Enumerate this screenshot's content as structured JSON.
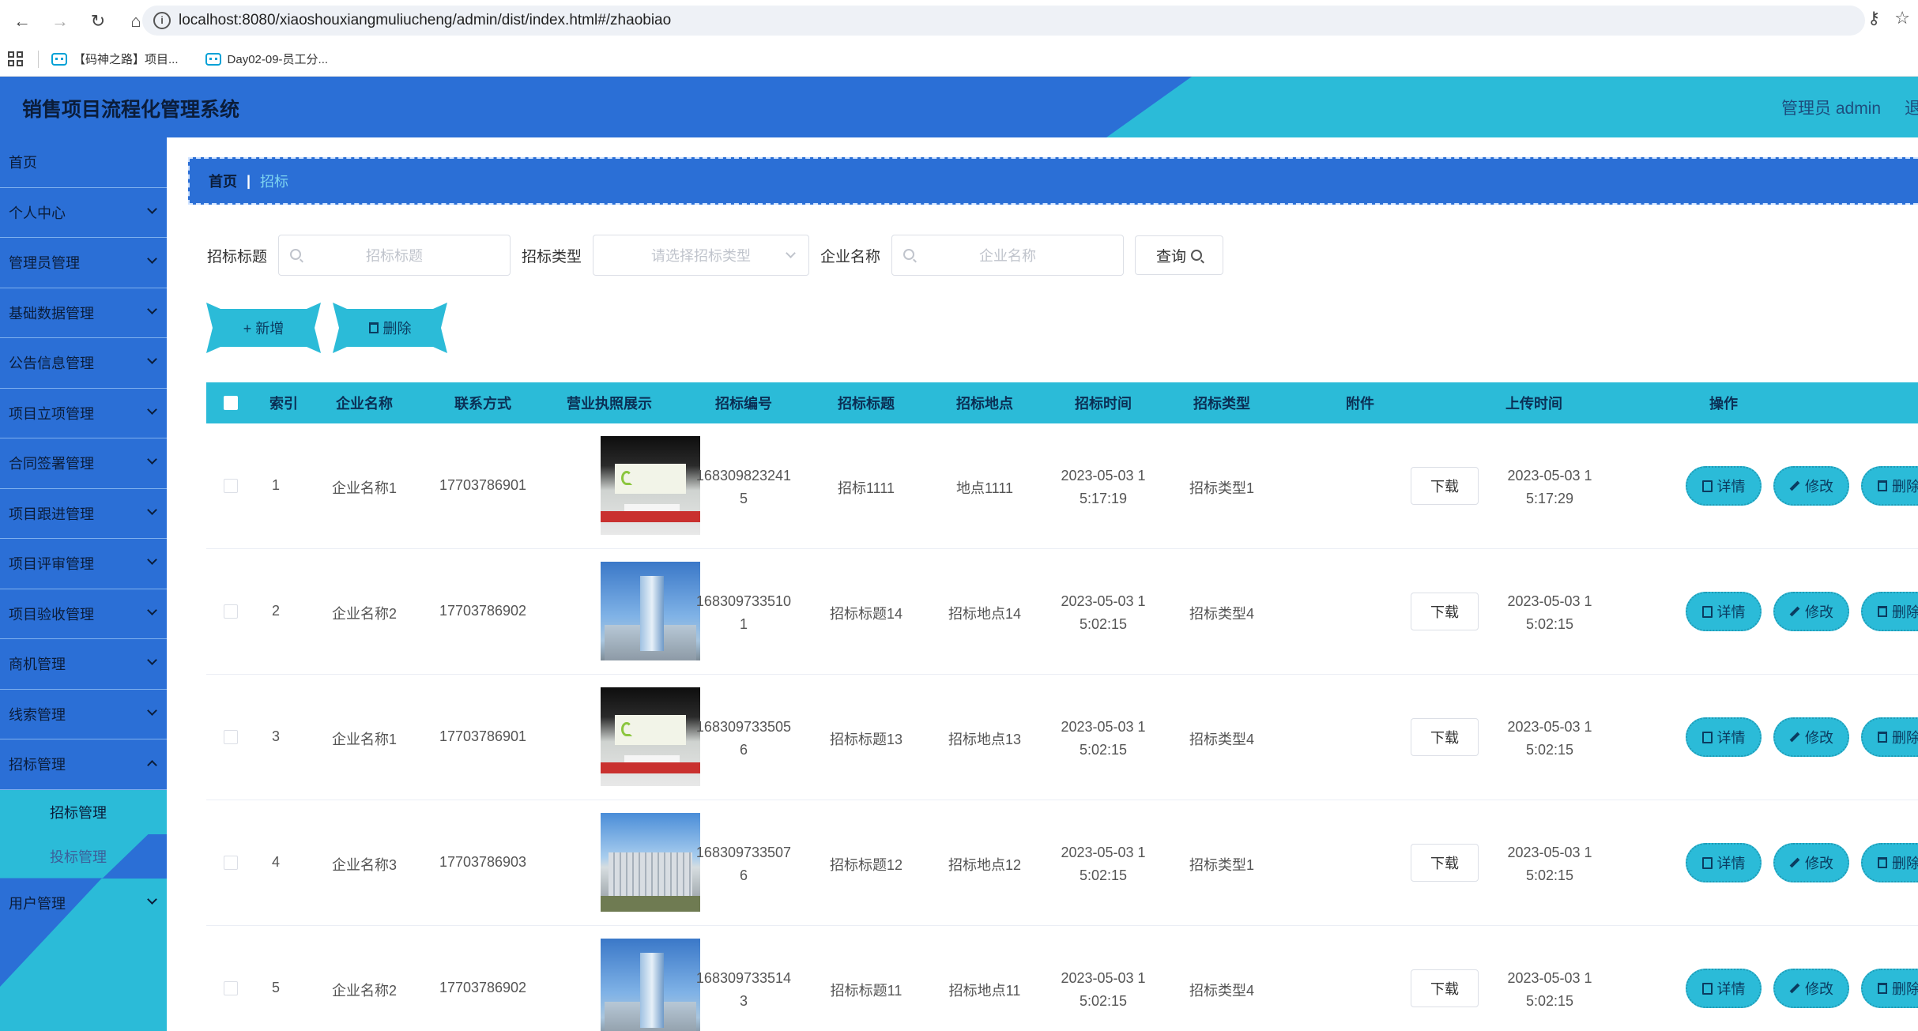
{
  "browser": {
    "url": "localhost:8080/xiaoshouxiangmuliucheng/admin/dist/index.html#/zhaobiao",
    "bookmarks": [
      "【码神之路】项目...",
      "Day02-09-员工分..."
    ]
  },
  "header": {
    "title": "销售项目流程化管理系统",
    "user": "管理员 admin",
    "logout": "退"
  },
  "sidebar": {
    "items": [
      {
        "label": "首页"
      },
      {
        "label": "个人中心"
      },
      {
        "label": "管理员管理"
      },
      {
        "label": "基础数据管理"
      },
      {
        "label": "公告信息管理"
      },
      {
        "label": "项目立项管理"
      },
      {
        "label": "合同签署管理"
      },
      {
        "label": "项目跟进管理"
      },
      {
        "label": "项目评审管理"
      },
      {
        "label": "项目验收管理"
      },
      {
        "label": "商机管理"
      },
      {
        "label": "线索管理"
      },
      {
        "label": "招标管理"
      }
    ],
    "sub_items": [
      "招标管理",
      "投标管理"
    ],
    "last_item": "用户管理"
  },
  "breadcrumb": {
    "home": "首页",
    "sep": "|",
    "current": "招标"
  },
  "search": {
    "title_label": "招标标题",
    "title_placeholder": "招标标题",
    "type_label": "招标类型",
    "type_placeholder": "请选择招标类型",
    "company_label": "企业名称",
    "company_placeholder": "企业名称",
    "query_button": "查询"
  },
  "actions": {
    "add": "+ 新增",
    "delete": "删除"
  },
  "table": {
    "columns": [
      "索引",
      "企业名称",
      "联系方式",
      "营业执照展示",
      "招标编号",
      "招标标题",
      "招标地点",
      "招标时间",
      "招标类型",
      "附件",
      "上传时间",
      "操作"
    ],
    "download_label": "下载",
    "op_labels": [
      "详情",
      "修改",
      "删除"
    ],
    "rows": [
      {
        "index": "1",
        "company": "企业名称1",
        "phone": "17703786901",
        "image": "lobby",
        "code_a": "168309823241",
        "code_b": "5",
        "title": "招标1111",
        "place": "地点1111",
        "time_a": "2023-05-03 1",
        "time_b": "5:17:19",
        "type": "招标类型1",
        "upload_a": "2023-05-03 1",
        "upload_b": "5:17:29"
      },
      {
        "index": "2",
        "company": "企业名称2",
        "phone": "17703786902",
        "image": "tower",
        "code_a": "168309733510",
        "code_b": "1",
        "title": "招标标题14",
        "place": "招标地点14",
        "time_a": "2023-05-03 1",
        "time_b": "5:02:15",
        "type": "招标类型4",
        "upload_a": "2023-05-03 1",
        "upload_b": "5:02:15"
      },
      {
        "index": "3",
        "company": "企业名称1",
        "phone": "17703786901",
        "image": "lobby",
        "code_a": "168309733505",
        "code_b": "6",
        "title": "招标标题13",
        "place": "招标地点13",
        "time_a": "2023-05-03 1",
        "time_b": "5:02:15",
        "type": "招标类型4",
        "upload_a": "2023-05-03 1",
        "upload_b": "5:02:15"
      },
      {
        "index": "4",
        "company": "企业名称3",
        "phone": "17703786903",
        "image": "campus",
        "code_a": "168309733507",
        "code_b": "6",
        "title": "招标标题12",
        "place": "招标地点12",
        "time_a": "2023-05-03 1",
        "time_b": "5:02:15",
        "type": "招标类型1",
        "upload_a": "2023-05-03 1",
        "upload_b": "5:02:15"
      },
      {
        "index": "5",
        "company": "企业名称2",
        "phone": "17703786902",
        "image": "tower",
        "code_a": "168309733514",
        "code_b": "3",
        "title": "招标标题11",
        "place": "招标地点11",
        "time_a": "2023-05-03 1",
        "time_b": "5:02:15",
        "type": "招标类型4",
        "upload_a": "2023-05-03 1",
        "upload_b": "5:02:15"
      }
    ]
  }
}
